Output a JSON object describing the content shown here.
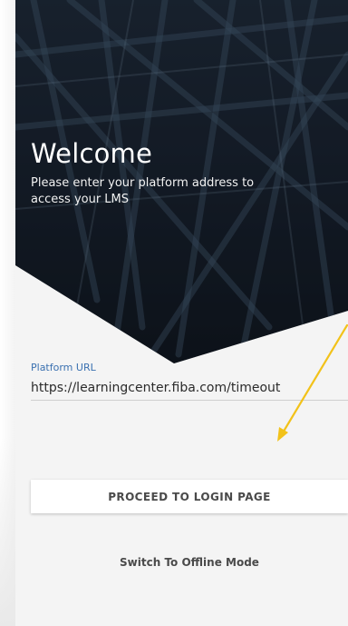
{
  "hero": {
    "title": "Welcome",
    "subtitle": "Please enter your platform address to access your LMS"
  },
  "form": {
    "url_label": "Platform URL",
    "url_value": "https://learningcenter.fiba.com/timeout"
  },
  "actions": {
    "proceed_label": "PROCEED TO LOGIN PAGE",
    "offline_label": "Switch To Offline Mode"
  },
  "annotation": {
    "arrow_color": "#f2c21a"
  },
  "colors": {
    "hero_background": "#16202c",
    "label_accent": "#3a70b0",
    "screen_background": "#f4f4f4"
  }
}
